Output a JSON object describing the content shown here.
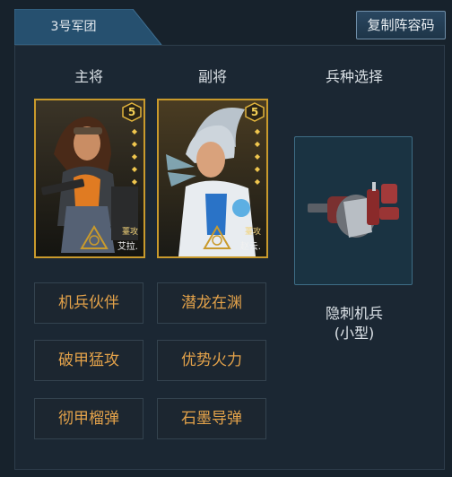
{
  "tab": {
    "label": "3号军团"
  },
  "copy_button": {
    "label": "复制阵容码"
  },
  "columns": {
    "main": "主将",
    "deputy": "副将",
    "troop": "兵种选择"
  },
  "generals": [
    {
      "slot": "main",
      "rank": "5",
      "role": "薹攻",
      "name": "艾拉."
    },
    {
      "slot": "deputy",
      "rank": "5",
      "role": "薹攻",
      "name": "赵云."
    }
  ],
  "troop": {
    "name": "隐刺机兵",
    "size": "(小型)"
  },
  "skills": [
    "机兵伙伴",
    "潜龙在渊",
    "破甲猛攻",
    "优势火力",
    "彻甲榴弹",
    "石墨导弹"
  ],
  "colors": {
    "accent_gold": "#c99a2c",
    "skill_text": "#e3a24a",
    "tab_bg": "#244d6e"
  }
}
